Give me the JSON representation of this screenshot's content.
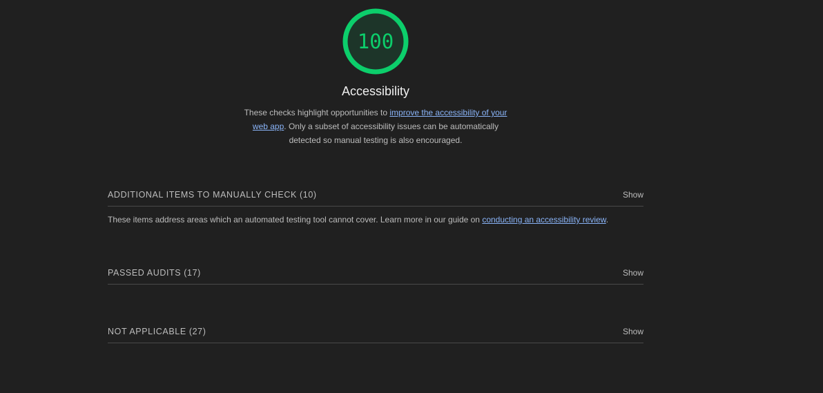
{
  "score": {
    "value": "100",
    "fraction": 1.0,
    "color": "#0cce6b"
  },
  "category": {
    "title": "Accessibility",
    "description_pre": "These checks highlight opportunities to ",
    "description_link": "improve the accessibility of your web app",
    "description_post": ". Only a subset of accessibility issues can be automatically detected so manual testing is also encouraged."
  },
  "groups": [
    {
      "title": "ADDITIONAL ITEMS TO MANUALLY CHECK (10)",
      "toggle": "Show",
      "desc_pre": "These items address areas which an automated testing tool cannot cover. Learn more in our guide on ",
      "desc_link": "conducting an accessibility review",
      "desc_post": "."
    },
    {
      "title": "PASSED AUDITS (17)",
      "toggle": "Show"
    },
    {
      "title": "NOT APPLICABLE (27)",
      "toggle": "Show"
    }
  ],
  "colors": {
    "background": "#202020",
    "pass": "#0cce6b",
    "link": "#8ab4f8"
  }
}
